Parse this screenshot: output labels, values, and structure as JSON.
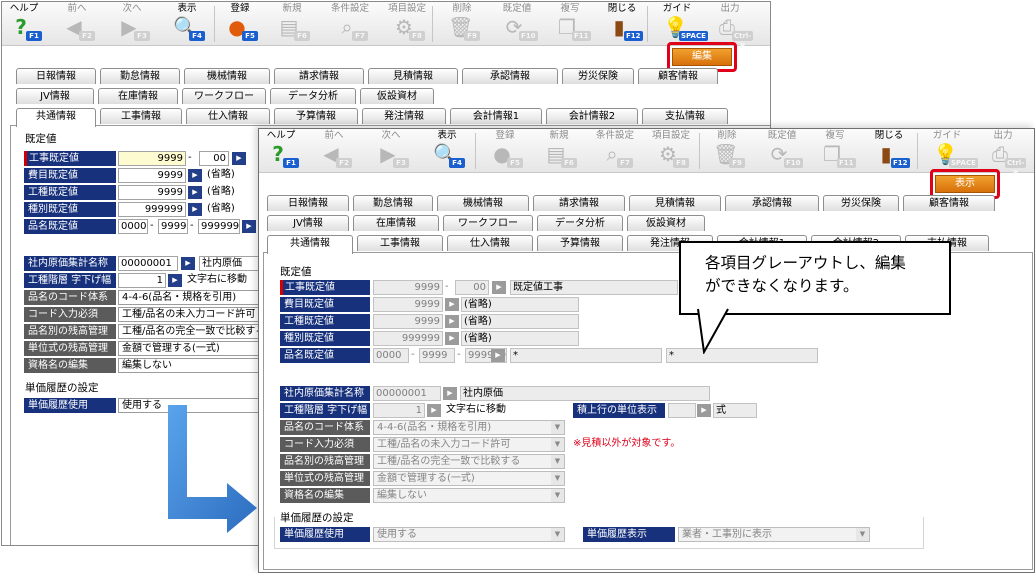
{
  "toolbar": {
    "help": "ヘルプ",
    "prev": "前へ",
    "next": "次へ",
    "display": "表示",
    "register": "登録",
    "new": "新規",
    "condition": "条件設定",
    "item_setting": "項目設定",
    "delete": "削除",
    "default_value": "既定値",
    "copy": "複写",
    "close": "閉じる",
    "guide": "ガイド",
    "output": "出力",
    "keys": {
      "f1": "F1",
      "f2": "F2",
      "f3": "F3",
      "f4": "F4",
      "f5": "F5",
      "f6": "F6",
      "f7": "F7",
      "f8": "F8",
      "f9": "F9",
      "f10": "F10",
      "f11": "F11",
      "f12": "F12",
      "space": "SPACE",
      "ctrlp": "Ctrl-P"
    }
  },
  "mode_buttons": {
    "edit": "編集",
    "view": "表示"
  },
  "tabs": {
    "row1": [
      "日報情報",
      "勤怠情報",
      "機械情報",
      "請求情報",
      "見積情報",
      "承認情報",
      "労災保険",
      "顧客情報"
    ],
    "row2": [
      "JV情報",
      "在庫情報",
      "ワークフロー",
      "データ分析",
      "仮設資材"
    ],
    "row3": [
      "共通情報",
      "工事情報",
      "仕入情報",
      "予算情報",
      "発注情報",
      "会計情報1",
      "会計情報2",
      "支払情報"
    ]
  },
  "form": {
    "section_default": "既定値",
    "labels": {
      "koji": "工事既定値",
      "hiyo": "費目既定値",
      "kosyu": "工種既定値",
      "syubetsu": "種別既定値",
      "hinmei": "品名既定値",
      "shanai": "社内原価集計名称",
      "kosyu_kaiso": "工種階層 字下げ幅",
      "hinmei_code": "品名のコード体系",
      "code_input": "コード入力必須",
      "hinmei_zandaka": "品名別の残高管理",
      "tanka_zandaka": "単位式の残高管理",
      "shikaku": "資格名の編集",
      "tanka_rireki_shiyo": "単価履歴使用",
      "tanka_rireki_hyoji": "単価履歴表示",
      "tsumiage": "積上行の単位表示"
    },
    "values": {
      "koji_code": "9999",
      "koji_sub": "00",
      "koji_name": "既定値工事",
      "hiyo_code": "9999",
      "kosyu_code": "9999",
      "syubetsu_code": "999999",
      "omit": "(省略)",
      "hinmei_a": "0000",
      "hinmei_b": "9999",
      "hinmei_c": "999999",
      "hinmei_star": "*",
      "shanai_code": "00000001",
      "shanai_name": "社内原価",
      "kosyu_width": "1",
      "kosyu_text": "文字右に移動",
      "hinmei_code": "4-4-6(品名・規格を引用)",
      "code_input": "工種/品名の未入力コード許可",
      "hinmei_zandaka": "工種/品名の完全一致で比較する",
      "tanka_zandaka": "金額で管理する(一式)",
      "shikaku": "編集しない",
      "tanka_rireki_shiyo": "使用する",
      "tanka_rireki_hyoji": "業者・工事別に表示",
      "tsumiage": "式"
    },
    "section_price_history": "単価履歴の設定",
    "note": "※見積以外が対象です。"
  },
  "callout": {
    "line1": "各項目グレーアウトし、編集",
    "line2": "ができなくなります。"
  },
  "colors": {
    "label_bg": "#17317d",
    "mode_button": "#e4800f",
    "highlight": "#e0001a",
    "arrow": "#3f86d6"
  }
}
